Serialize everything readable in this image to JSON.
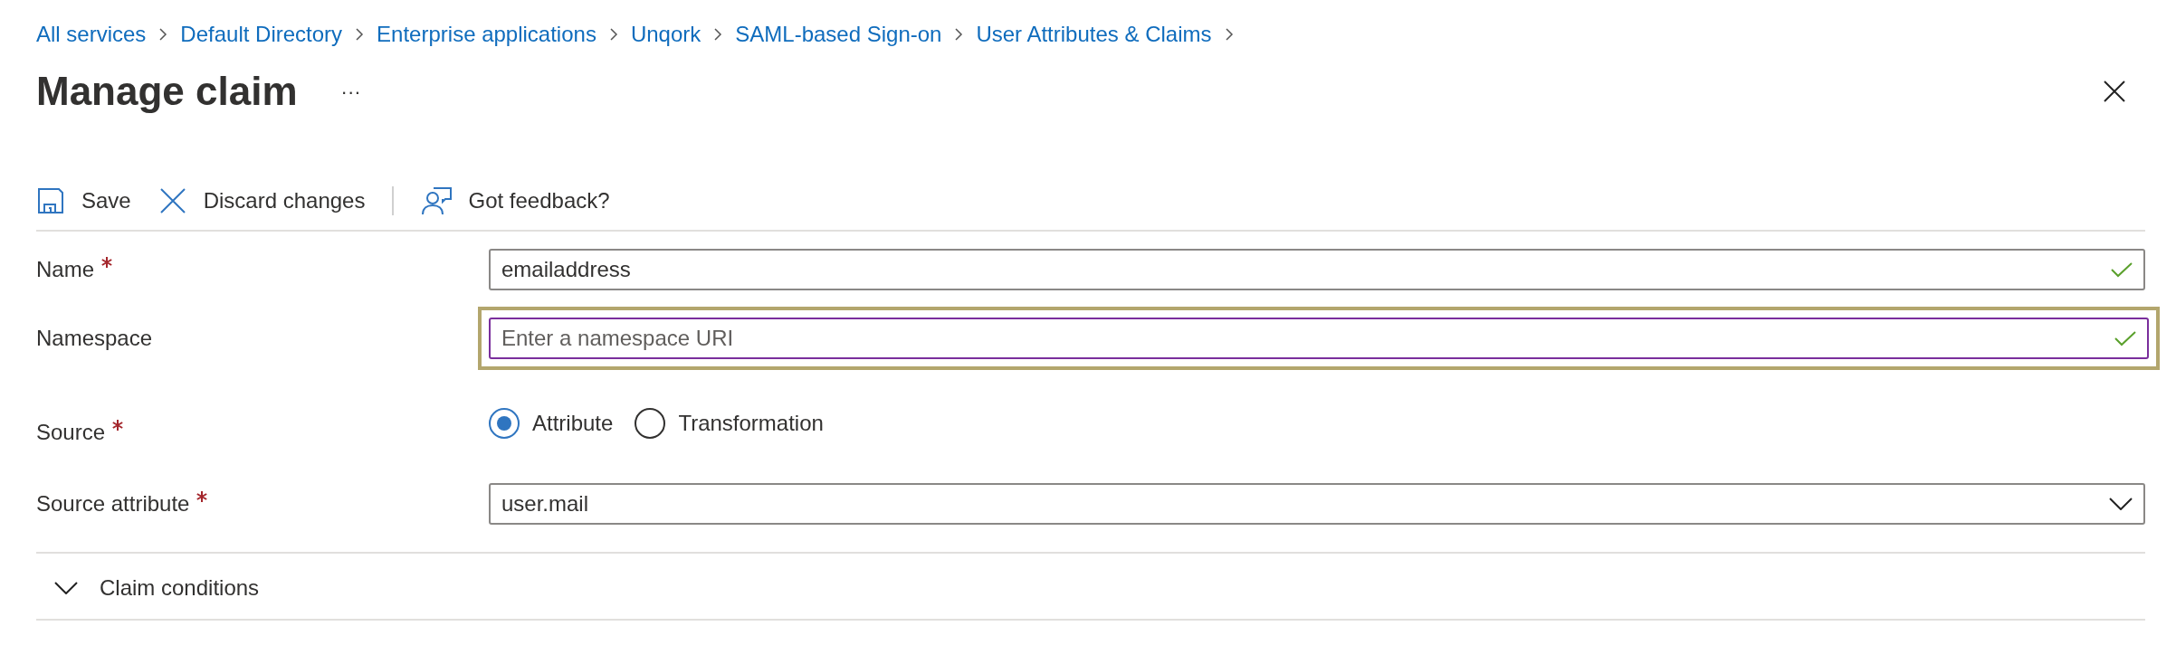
{
  "breadcrumb": [
    "All services",
    "Default Directory",
    "Enterprise applications",
    "Unqork",
    "SAML-based Sign-on",
    "User Attributes & Claims"
  ],
  "title": "Manage claim",
  "more": "···",
  "toolbar": [
    {
      "label": "Save",
      "kind": "save"
    },
    {
      "label": "Discard changes",
      "kind": "discard"
    },
    {
      "label": "Got feedback?",
      "kind": "feedback"
    }
  ],
  "fields": [
    {
      "kind": "text",
      "label": "Name",
      "required": true,
      "value": "emailaddress",
      "valid": true,
      "highlighted": false
    },
    {
      "kind": "text",
      "label": "Namespace",
      "required": false,
      "placeholder": "Enter a namespace URI",
      "valid": true,
      "highlighted": true
    },
    {
      "kind": "radio",
      "label": "Source",
      "required": true,
      "options": [
        {
          "label": "Attribute",
          "selected": true
        },
        {
          "label": "Transformation",
          "selected": false
        }
      ]
    },
    {
      "kind": "dropdown",
      "label": "Source attribute",
      "required": true,
      "value": "user.mail"
    }
  ],
  "section": {
    "label": "Claim conditions",
    "expanded": false
  }
}
